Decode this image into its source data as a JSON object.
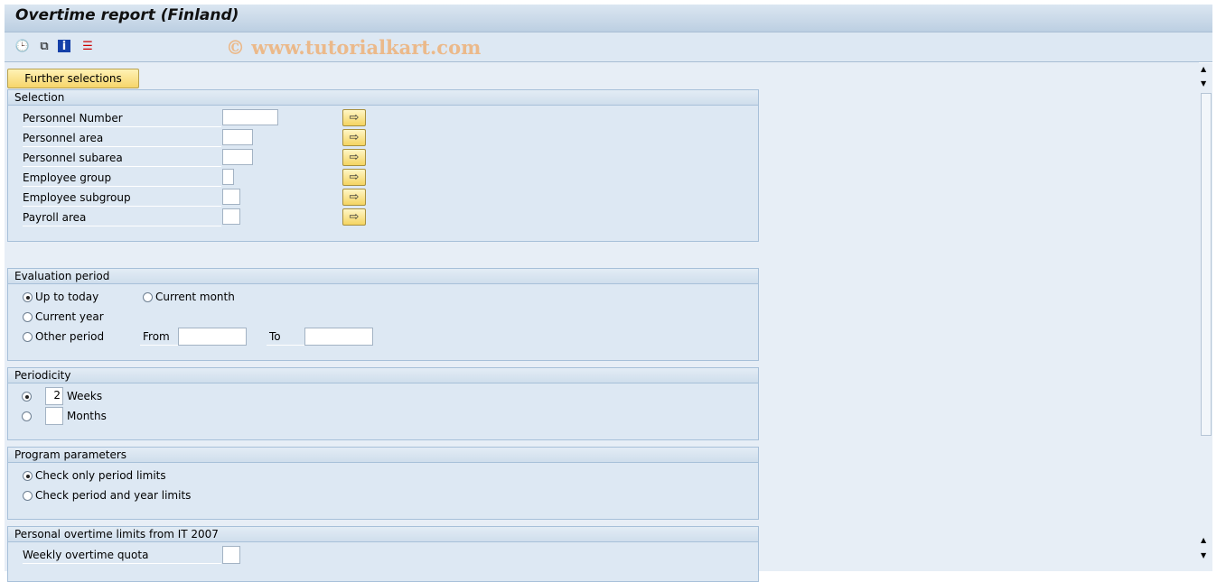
{
  "title": "Overtime report (Finland)",
  "watermark": "© www.tutorialkart.com",
  "toolbar": {
    "icons": [
      "execute-icon",
      "variants-icon",
      "info-icon",
      "selection-options-icon"
    ]
  },
  "further_selections": "Further selections",
  "selection": {
    "header": "Selection",
    "rows": [
      {
        "label": "Personnel Number",
        "value": ""
      },
      {
        "label": "Personnel area",
        "value": ""
      },
      {
        "label": "Personnel subarea",
        "value": ""
      },
      {
        "label": "Employee group",
        "value": ""
      },
      {
        "label": "Employee subgroup",
        "value": ""
      },
      {
        "label": "Payroll area",
        "value": ""
      }
    ]
  },
  "evaluation": {
    "header": "Evaluation period",
    "up_to_today": "Up to today",
    "current_month": "Current month",
    "current_year": "Current year",
    "other_period": "Other period",
    "from": "From",
    "to": "To",
    "from_value": "",
    "to_value": "",
    "selected": "Up to today"
  },
  "periodicity": {
    "header": "Periodicity",
    "weeks": "Weeks",
    "weeks_value": "2",
    "months": "Months",
    "months_value": "",
    "selected": "Weeks"
  },
  "program": {
    "header": "Program parameters",
    "opt1": "Check only period limits",
    "opt2": "Check period and year limits",
    "selected": "Check only period limits"
  },
  "personal": {
    "header": "Personal overtime limits from IT 2007",
    "weekly": "Weekly overtime quota",
    "weekly_value": ""
  }
}
